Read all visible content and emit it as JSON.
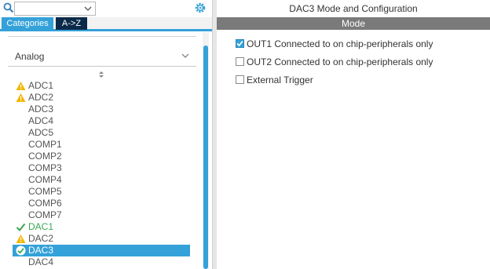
{
  "search": {
    "value": "",
    "placeholder": ""
  },
  "tabs": {
    "categories": "Categories",
    "az": "A->Z"
  },
  "group": {
    "label": "Analog"
  },
  "items": [
    {
      "label": "ADC1",
      "status": "warning"
    },
    {
      "label": "ADC2",
      "status": "warning"
    },
    {
      "label": "ADC3",
      "status": "none"
    },
    {
      "label": "ADC4",
      "status": "none"
    },
    {
      "label": "ADC5",
      "status": "none"
    },
    {
      "label": "COMP1",
      "status": "none"
    },
    {
      "label": "COMP2",
      "status": "none"
    },
    {
      "label": "COMP3",
      "status": "none"
    },
    {
      "label": "COMP4",
      "status": "none"
    },
    {
      "label": "COMP5",
      "status": "none"
    },
    {
      "label": "COMP6",
      "status": "none"
    },
    {
      "label": "COMP7",
      "status": "none"
    },
    {
      "label": "DAC1",
      "status": "ok"
    },
    {
      "label": "DAC2",
      "status": "warning"
    },
    {
      "label": "DAC3",
      "status": "selected-ok"
    },
    {
      "label": "DAC4",
      "status": "none"
    }
  ],
  "right": {
    "title": "DAC3 Mode and Configuration",
    "mode_bar": "Mode",
    "options": [
      {
        "label": "OUT1 Connected to on chip-peripherals only",
        "checked": true
      },
      {
        "label": "OUT2 Connected to on chip-peripherals only",
        "checked": false
      },
      {
        "label": "External Trigger",
        "checked": false
      }
    ]
  },
  "colors": {
    "accent": "#34a1d9",
    "tab_dark": "#0b2a4a",
    "warning": "#f2b705",
    "ok": "#3aa853",
    "mode_bar": "#7a7a7a"
  }
}
